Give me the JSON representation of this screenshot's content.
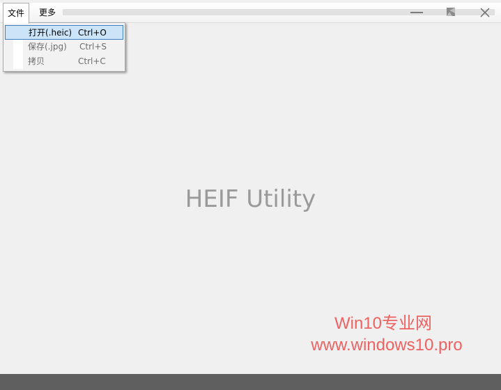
{
  "menubar": {
    "file": "文件",
    "more": "更多"
  },
  "window_controls": {
    "minimize": "minimize-icon",
    "maximize": "maximize-icon",
    "close": "close-icon"
  },
  "file_menu": {
    "items": [
      {
        "label": "打开(.heic)",
        "shortcut": "Ctrl+O",
        "state": "highlighted"
      },
      {
        "label": "保存(.jpg)",
        "shortcut": "Ctrl+S",
        "state": "disabled"
      },
      {
        "label": "拷贝",
        "shortcut": "Ctrl+C",
        "state": "disabled"
      }
    ]
  },
  "main": {
    "title": "HEIF Utility"
  },
  "watermark": {
    "line1": "Win10专业网",
    "line2": "www.windows10.pro"
  },
  "colors": {
    "highlight_bg": "#cce4f7",
    "highlight_border": "#3d7ec1",
    "watermark": "#ee6262",
    "taskbar": "#5f5f5f"
  }
}
